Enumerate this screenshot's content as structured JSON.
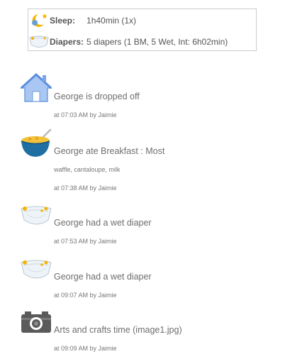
{
  "summary": {
    "sleep": {
      "icon": "sleep-moon-icon",
      "label": "Sleep:",
      "value": "1h40min (1x)"
    },
    "diapers": {
      "icon": "diaper-icon",
      "label": "Diapers:",
      "value": "5 diapers (1 BM, 5 Wet, Int: 6h02min)"
    }
  },
  "entries": [
    {
      "icon": "house-icon",
      "title": "George is dropped off",
      "meta": "at 07:03 AM by Jaimie"
    },
    {
      "icon": "cereal-bowl-icon",
      "title": "George ate Breakfast : Most",
      "detail": "waffle, cantaloupe, milk",
      "meta": "at 07:38 AM by Jaimie"
    },
    {
      "icon": "diaper-icon",
      "title": "George had a wet diaper",
      "meta": "at 07:53 AM by Jaimie"
    },
    {
      "icon": "diaper-icon",
      "title": "George had a wet diaper",
      "meta": "at 09:07 AM by Jaimie"
    },
    {
      "icon": "camera-icon",
      "title": "Arts and crafts time (image1.jpg)",
      "meta": "at 09:09 AM by Jaimie"
    }
  ],
  "colors": {
    "house": "#7aa6e8",
    "bowl": "#1f6fa3",
    "camera": "#555555",
    "text": "#6e6e6e"
  }
}
